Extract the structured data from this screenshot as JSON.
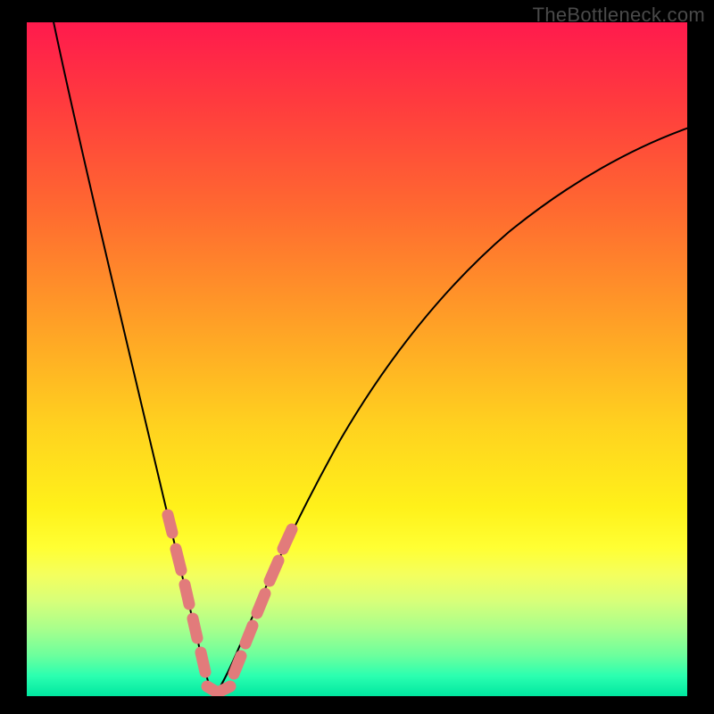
{
  "watermark": "TheBottleneck.com",
  "colors": {
    "marker": "#e27b7b",
    "curve": "#000000",
    "frame": "#000000"
  },
  "chart_data": {
    "type": "line",
    "title": "",
    "xlabel": "",
    "ylabel": "",
    "xlim": [
      0,
      100
    ],
    "ylim": [
      0,
      100
    ],
    "grid": false,
    "legend": false,
    "note": "V-shaped absolute-deviation style curve. Minimum (valley) at x≈27, y≈0. Left branch rises steeply to y≈100 at x≈5; right branch rises with decreasing slope to y≈82 at x=100.",
    "series": [
      {
        "name": "curve",
        "x": [
          5,
          8,
          12,
          16,
          20,
          23,
          25,
          27,
          29,
          31,
          34,
          38,
          45,
          55,
          65,
          75,
          85,
          95,
          100
        ],
        "y": [
          100,
          85,
          66,
          48,
          30,
          16,
          7,
          0,
          6,
          14,
          24,
          35,
          48,
          58,
          66,
          72,
          76,
          80,
          82
        ]
      }
    ],
    "markers": {
      "name": "highlighted-segments",
      "style": "rounded-capsule",
      "color": "#e27b7b",
      "x": [
        20,
        21.5,
        23,
        24,
        25,
        26.5,
        28.5,
        30,
        31,
        32.5,
        34,
        35.5
      ],
      "y": [
        29,
        23,
        16,
        11,
        5,
        1,
        1,
        6,
        12,
        18,
        24,
        29
      ]
    }
  }
}
